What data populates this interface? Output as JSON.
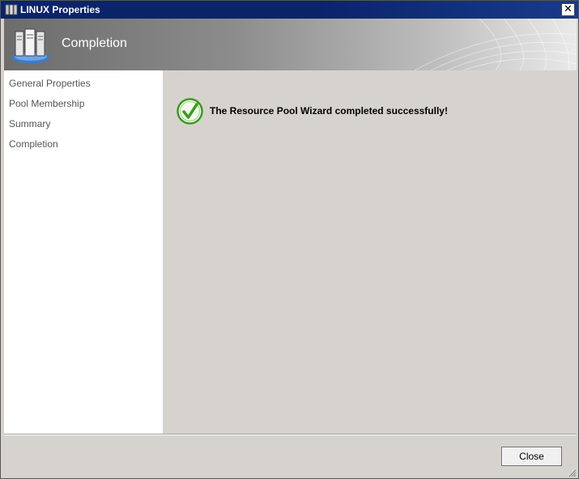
{
  "window": {
    "title": "LINUX Properties",
    "close_glyph": "✕"
  },
  "banner": {
    "title": "Completion",
    "icon": "server-stack-icon"
  },
  "nav": {
    "items": [
      {
        "label": "General Properties"
      },
      {
        "label": "Pool Membership"
      },
      {
        "label": "Summary"
      },
      {
        "label": "Completion"
      }
    ]
  },
  "content": {
    "message": "The Resource Pool Wizard completed successfully!",
    "status_icon": "success-check-icon"
  },
  "footer": {
    "close_label": "Close"
  },
  "colors": {
    "titlebar": "#0a246a",
    "success_green": "#3a9a1e"
  }
}
